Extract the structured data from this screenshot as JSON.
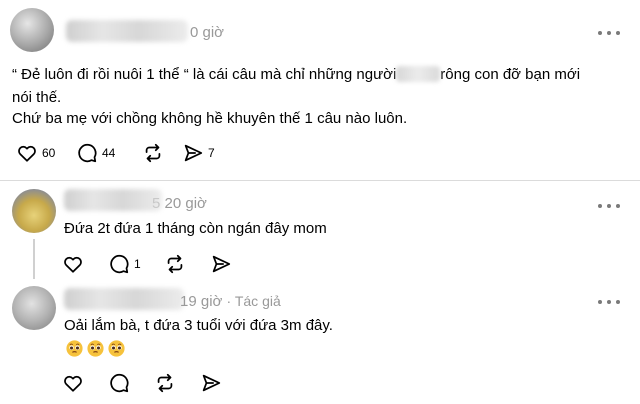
{
  "post": {
    "time": "0 giờ",
    "line1": "“ Đẻ luôn đi rồi nuôi 1 thể “ là cái câu mà chỉ những người",
    "line1_tail": "rông con đỡ bạn mới",
    "line2": "nói thế.",
    "line3": "Chứ ba mẹ với chồng không hề khuyên thế 1 câu nào luôn.",
    "likes": "60",
    "comments": "44",
    "shares": "7"
  },
  "reply1": {
    "time_prefix": "5",
    "time": "20 giờ",
    "text": "Đứa 2t đứa 1 tháng còn ngán đây mom",
    "comments": "1"
  },
  "reply2": {
    "time": "19 giờ",
    "author_tag": "· Tác giả",
    "text": "Oải lắm bà, t đứa 3 tuổi với đứa 3m đây."
  },
  "icons": [
    "heart-icon",
    "comment-icon",
    "repost-icon",
    "share-icon",
    "more-icon",
    "pleading-face-emoji"
  ],
  "colors": {
    "text": "#000000",
    "muted": "#999999",
    "divider": "#dbdbdb"
  }
}
